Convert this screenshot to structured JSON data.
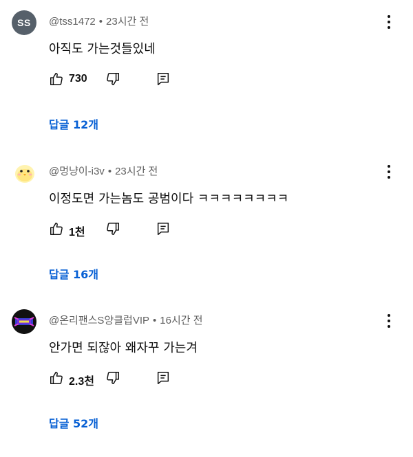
{
  "comments": [
    {
      "avatar_text": "SS",
      "avatar_color": "#56606a",
      "author": "@tss1472",
      "time": "23시간 전",
      "text": "아직도 가는것들있네",
      "likes": "730",
      "replies_label": "답글 12개"
    },
    {
      "avatar_icon": "chick-avatar-icon",
      "author": "@멍냥이-i3v",
      "time": "23시간 전",
      "text": "이정도면 가는놈도 공범이다 ㅋㅋㅋㅋㅋㅋㅋㅋ",
      "likes": "1천",
      "replies_label": "답글 16개"
    },
    {
      "avatar_icon": "club-logo-avatar-icon",
      "author": "@온리팬스S양클럽VIP",
      "time": "16시간 전",
      "text": "안가면 되잖아 왜자꾸 가는겨",
      "likes": "2.3천",
      "replies_label": "답글 52개"
    }
  ],
  "separator": "•",
  "colors": {
    "link": "#065fd4",
    "meta": "#606060",
    "text": "#0f0f0f"
  }
}
